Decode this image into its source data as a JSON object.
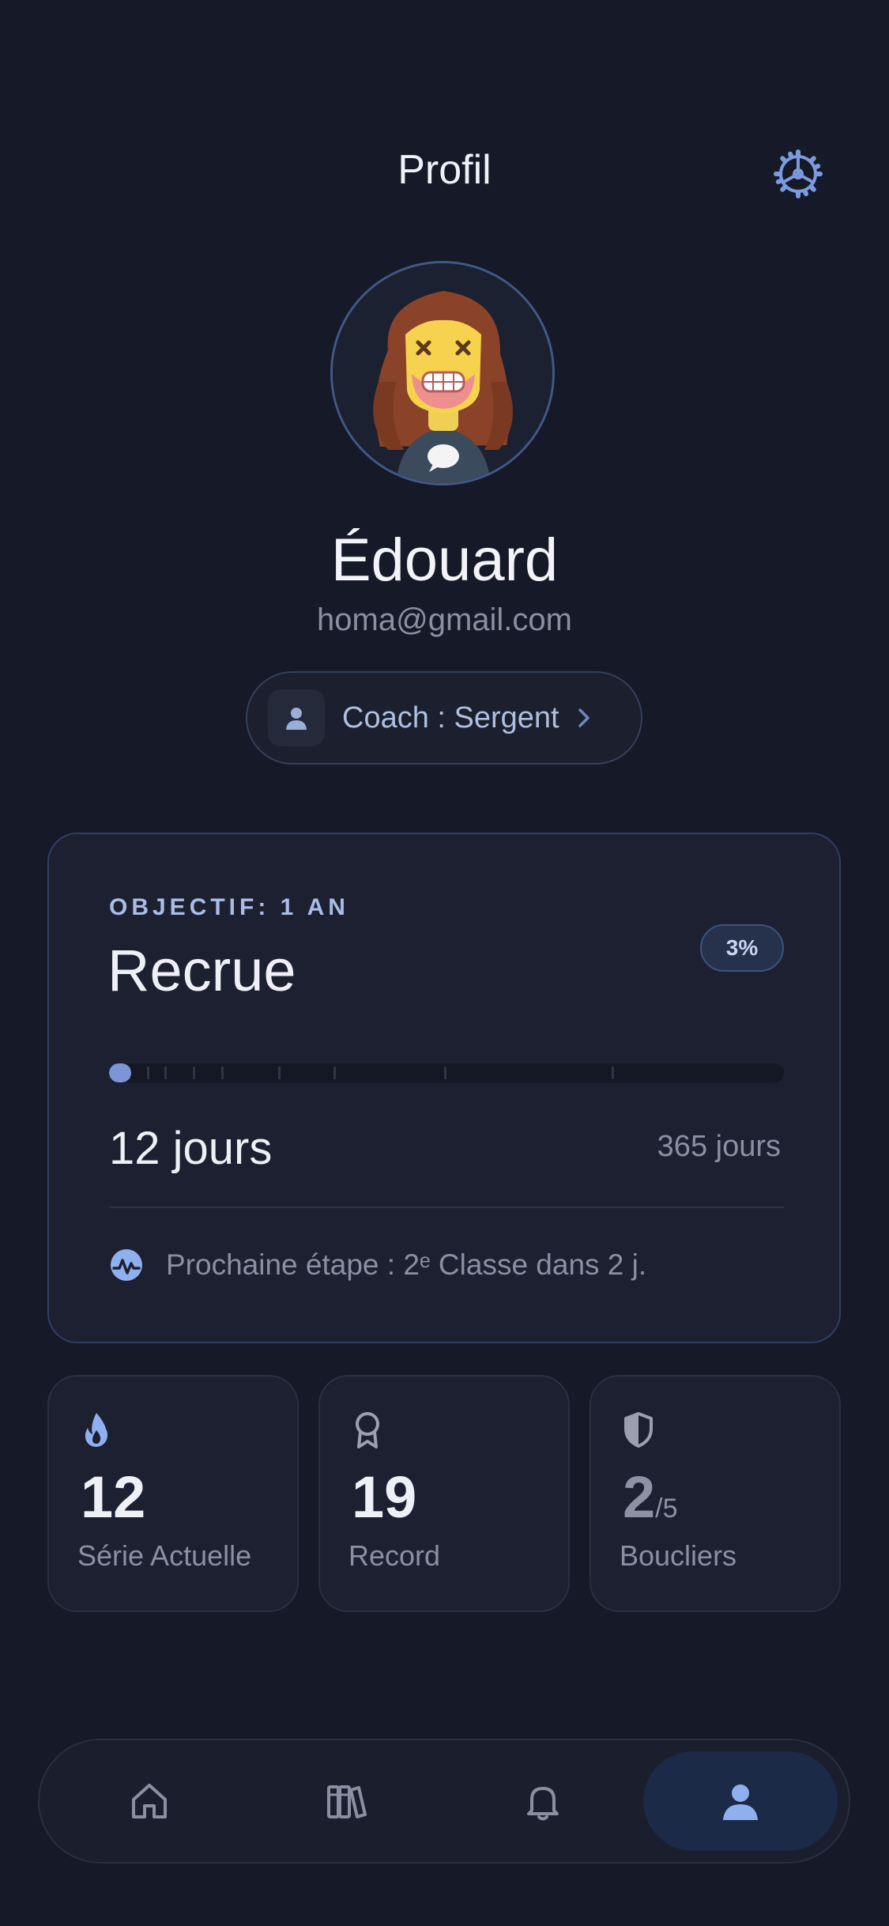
{
  "header": {
    "title": "Profil",
    "settings_icon": "gear-icon"
  },
  "profile": {
    "name": "Édouard",
    "email": "homa@gmail.com",
    "avatar_icon": "avatar-illustration",
    "coach": {
      "label": "Coach : Sergent",
      "icon": "person-icon",
      "chevron_icon": "chevron-right-icon"
    }
  },
  "goal": {
    "objective": "OBJECTIF: 1 AN",
    "rank": "Recrue",
    "percent_label": "3%",
    "progress_fraction": 0.033,
    "days_current": "12 jours",
    "days_total": "365 jours",
    "next_step": "Prochaine étape : 2ᵉ Classe dans 2 j.",
    "next_step_icon": "activity-icon"
  },
  "stats": [
    {
      "value": "12",
      "suffix": "",
      "label": "Série Actuelle",
      "icon": "flame-icon"
    },
    {
      "value": "19",
      "suffix": "",
      "label": "Record",
      "icon": "award-icon"
    },
    {
      "value": "2",
      "suffix": "/5",
      "label": "Boucliers",
      "icon": "shield-icon"
    }
  ],
  "nav": {
    "items": [
      {
        "icon": "home-icon",
        "active": false
      },
      {
        "icon": "books-icon",
        "active": false
      },
      {
        "icon": "bell-icon",
        "active": false
      },
      {
        "icon": "user-icon",
        "active": true
      }
    ]
  },
  "colors": {
    "background": "#161927",
    "card": "#1d2030",
    "accent": "#7b95d6",
    "accent_nav": "#1a2a47"
  }
}
